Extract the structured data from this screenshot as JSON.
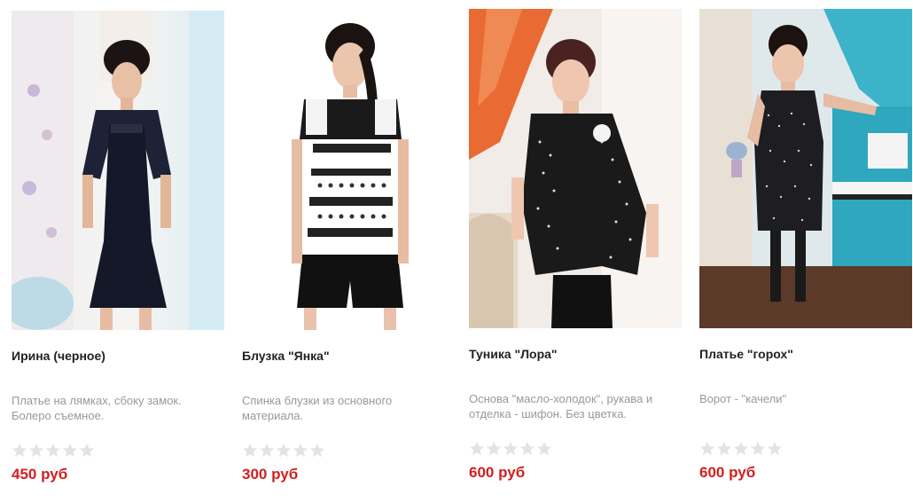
{
  "colors": {
    "price": "#d11f1f",
    "title": "#222222",
    "description": "#999999",
    "star_empty": "#e3e3e3"
  },
  "products": [
    {
      "title": "Ирина (черное)",
      "description": "Платье на лямках, сбоку замок. Болеро съемное.",
      "price": "450 руб",
      "rating": 0,
      "rating_max": 5
    },
    {
      "title": "Блузка \"Янка\"",
      "description": "Спинка блузки из основного материала.",
      "price": "300 руб",
      "rating": 0,
      "rating_max": 5
    },
    {
      "title": "Туника \"Лора\"",
      "description": "Основа \"масло-холодок\", рукава и отделка - шифон. Без цветка.",
      "price": "600 руб",
      "rating": 0,
      "rating_max": 5
    },
    {
      "title": "Платье \"горох\"",
      "description": "Ворот - \"качели\"",
      "price": "600 руб",
      "rating": 0,
      "rating_max": 5
    }
  ]
}
